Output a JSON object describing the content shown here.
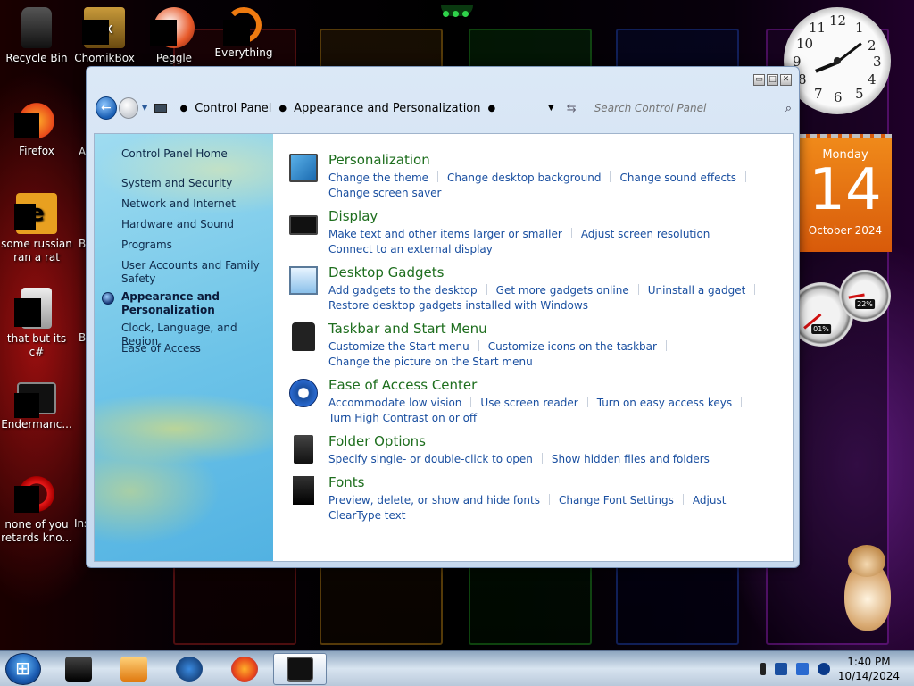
{
  "desktop": {
    "icons": [
      {
        "label": "Recycle Bin"
      },
      {
        "label": "ChomikBox",
        "glyph": "ox"
      },
      {
        "label": "Peggle Deluxe"
      },
      {
        "label": "Everything"
      },
      {
        "label": "Firefox"
      },
      {
        "label": "some russian ran a rat",
        "glyph": "e"
      },
      {
        "label": "that but its c#"
      },
      {
        "label": "Endermanc..."
      },
      {
        "label": "none of you retards kno..."
      }
    ],
    "partial_labels": [
      "A",
      "B",
      "B",
      "Ins"
    ]
  },
  "gadgets": {
    "clock_numbers": [
      "12",
      "1",
      "2",
      "3",
      "4",
      "5",
      "6",
      "7",
      "8",
      "9",
      "10",
      "11"
    ],
    "calendar": {
      "day": "Monday",
      "date": "14",
      "month": "October 2024"
    },
    "meters": [
      {
        "value": "01%"
      },
      {
        "value": "22%"
      }
    ]
  },
  "window": {
    "breadcrumb": [
      "Control Panel",
      "Appearance and Personalization"
    ],
    "search_placeholder": "Search Control Panel",
    "controls": {
      "minimize": "▭",
      "maximize": "□",
      "close": "✕"
    },
    "sidebar": {
      "home": "Control Panel Home",
      "items": [
        {
          "label": "System and Security"
        },
        {
          "label": "Network and Internet"
        },
        {
          "label": "Hardware and Sound"
        },
        {
          "label": "Programs"
        },
        {
          "label": "User Accounts and Family Safety"
        },
        {
          "label": "Appearance and Personalization"
        },
        {
          "label": "Clock, Language, and Region"
        },
        {
          "label": "Ease of Access"
        }
      ]
    },
    "sections": [
      {
        "title": "Personalization",
        "icon": "personalization-icon",
        "links": [
          "Change the theme",
          "Change desktop background",
          "Change sound effects",
          "Change screen saver"
        ]
      },
      {
        "title": "Display",
        "icon": "display-icon",
        "links": [
          "Make text and other items larger or smaller",
          "Adjust screen resolution",
          "Connect to an external display"
        ]
      },
      {
        "title": "Desktop Gadgets",
        "icon": "gadgets-icon",
        "links": [
          "Add gadgets to the desktop",
          "Get more gadgets online",
          "Uninstall a gadget",
          "Restore desktop gadgets installed with Windows"
        ]
      },
      {
        "title": "Taskbar and Start Menu",
        "icon": "taskbar-icon",
        "links": [
          "Customize the Start menu",
          "Customize icons on the taskbar",
          "Change the picture on the Start menu"
        ]
      },
      {
        "title": "Ease of Access Center",
        "icon": "ease-of-access-icon",
        "links": [
          "Accommodate low vision",
          "Use screen reader",
          "Turn on easy access keys",
          "Turn High Contrast on or off"
        ]
      },
      {
        "title": "Folder Options",
        "icon": "folder-options-icon",
        "links": [
          "Specify single- or double-click to open",
          "Show hidden files and folders"
        ]
      },
      {
        "title": "Fonts",
        "icon": "fonts-icon",
        "links": [
          "Preview, delete, or show and hide fonts",
          "Change Font Settings",
          "Adjust ClearType text"
        ]
      }
    ]
  },
  "taskbar": {
    "time": "1:40 PM",
    "date": "10/14/2024"
  },
  "colors": {
    "link": "#1a4fa0",
    "section_title": "#1e6e1e",
    "calendar": "#f08a1a"
  }
}
